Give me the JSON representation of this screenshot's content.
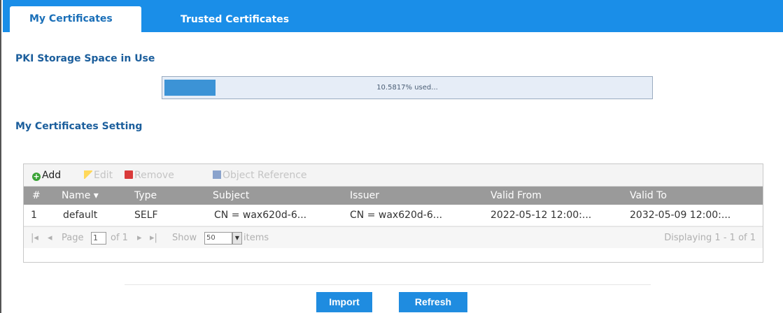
{
  "tabs": {
    "my_certificates": "My Certificates",
    "trusted_certificates": "Trusted Certificates"
  },
  "storage": {
    "title": "PKI Storage Space in Use",
    "used_text": "10.5817% used...",
    "used_percent": 10.5817
  },
  "settings": {
    "title": "My Certificates Setting"
  },
  "toolbar": {
    "add": "Add",
    "edit": "Edit",
    "remove": "Remove",
    "object_reference": "Object Reference"
  },
  "table": {
    "columns": [
      "#",
      "Name ▾",
      "Type",
      "Subject",
      "Issuer",
      "Valid From",
      "Valid To"
    ],
    "rows": [
      [
        "1",
        "default",
        "SELF",
        "CN = wax620d-6...",
        "CN = wax620d-6...",
        "2022-05-12 12:00:...",
        "2032-05-09 12:00:..."
      ]
    ]
  },
  "pager": {
    "first": "|◂",
    "prev": "◂",
    "page_label": "Page",
    "page_value": "1",
    "of_label": "of 1",
    "next": "▸",
    "last": "▸|",
    "show_label": "Show",
    "show_value": "50",
    "items_label": "items",
    "displaying": "Displaying 1 - 1 of 1"
  },
  "buttons": {
    "import": "Import",
    "refresh": "Refresh"
  },
  "colors": {
    "accent": "#1a8ee8",
    "section_title": "#1b5e9c",
    "header_bg": "#9a9a9a"
  }
}
